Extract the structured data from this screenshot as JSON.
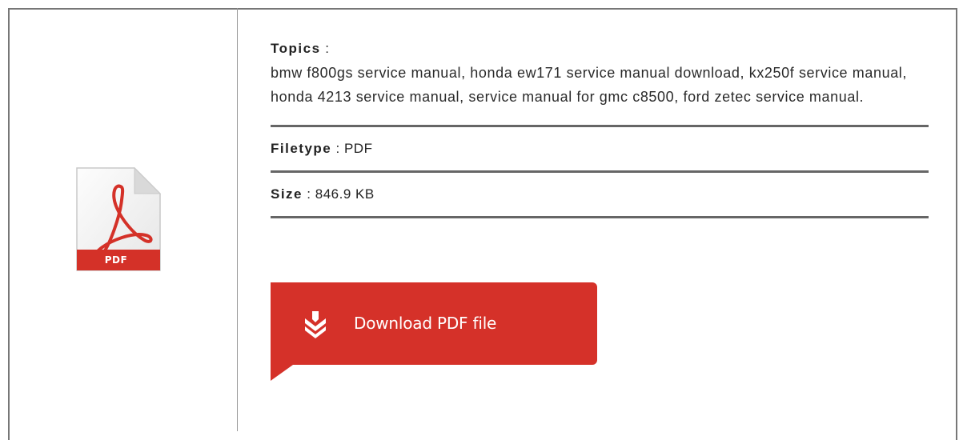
{
  "file_icon": {
    "type_label": "PDF",
    "icon_name": "pdf-file-icon"
  },
  "details": {
    "topics_label": "Topics",
    "separator": ":",
    "topics_text": "bmw f800gs service manual, honda ew171 service manual download, kx250f service manual, honda 4213 service manual, service manual for gmc c8500, ford zetec service manual.",
    "filetype_label": "Filetype",
    "filetype_value": "PDF",
    "size_label": "Size",
    "size_value": "846.9 KB"
  },
  "download": {
    "label": "Download PDF file",
    "icon_name": "download-arrow-icon",
    "color": "#d53129"
  }
}
